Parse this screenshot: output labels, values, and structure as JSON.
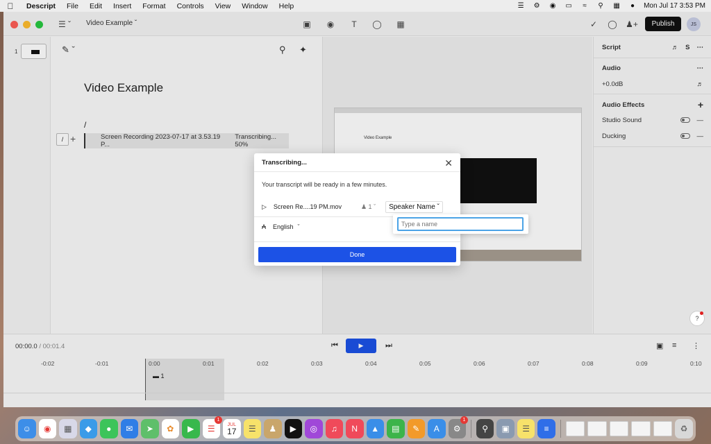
{
  "menubar": {
    "app": "Descript",
    "items": [
      "File",
      "Edit",
      "Insert",
      "Format",
      "Controls",
      "View",
      "Window",
      "Help"
    ],
    "clock": "Mon Jul 17  3:53 PM"
  },
  "window": {
    "project_name": "Video Example",
    "publish_label": "Publish",
    "avatar_initials": "JS"
  },
  "rail": {
    "scene_number": "1"
  },
  "editor": {
    "title": "Video Example",
    "slash": "/",
    "chip": "/",
    "file_row": "Screen Recording 2023-07-17 at 3.53.19 P...",
    "progress": "Transcribing... 50%"
  },
  "right_panel": {
    "script_label": "Script",
    "s_label": "S",
    "audio_label": "Audio",
    "gain": "+0.0dB",
    "effects_label": "Audio Effects",
    "studio_sound": "Studio Sound",
    "ducking": "Ducking"
  },
  "timeline": {
    "current_time": "00:00.0",
    "separator": "/",
    "total_time": "00:01.4",
    "ticks": [
      "-0:02",
      "-0:01",
      "0:00",
      "0:01",
      "0:02",
      "0:03",
      "0:04",
      "0:05",
      "0:06",
      "0:07",
      "0:08",
      "0:09",
      "0:10"
    ],
    "clip_label": "1"
  },
  "modal": {
    "title": "Transcribing...",
    "message": "Your transcript will be ready in a few minutes.",
    "file_name": "Screen Re....19 PM.mov",
    "speaker_count": "1",
    "speaker_name": "Speaker Name",
    "language": "English",
    "done_label": "Done"
  },
  "popover": {
    "placeholder": "Type a name"
  },
  "help": {
    "label": "?"
  },
  "dock": {
    "badges": {
      "reminders": "1",
      "system_settings": "1"
    },
    "calendar_month": "JUL",
    "calendar_day": "17"
  }
}
